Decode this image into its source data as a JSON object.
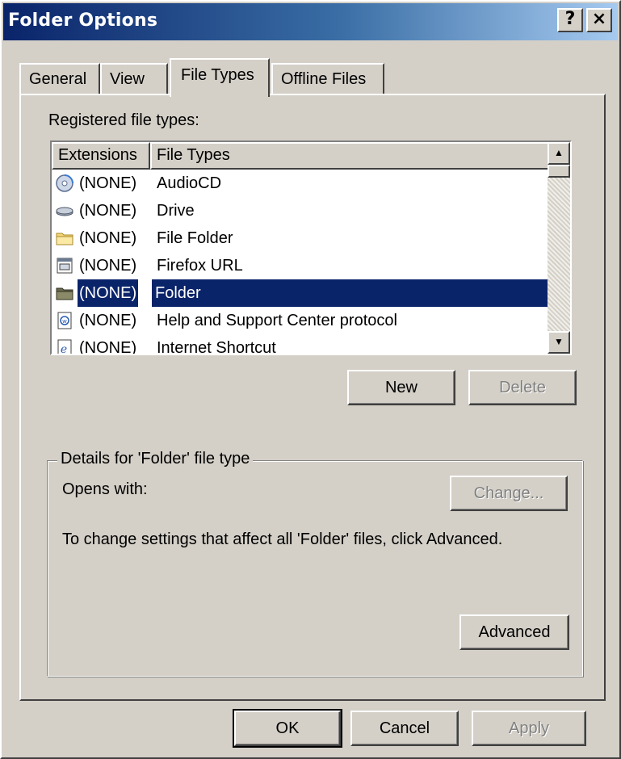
{
  "window": {
    "title": "Folder Options",
    "help_button": "?",
    "close_button": "×"
  },
  "tabs": [
    {
      "label": "General",
      "active": false
    },
    {
      "label": "View",
      "active": false
    },
    {
      "label": "File Types",
      "active": true
    },
    {
      "label": "Offline Files",
      "active": false
    }
  ],
  "file_types": {
    "label": "Registered file types:",
    "columns": [
      "Extensions",
      "File Types"
    ],
    "rows": [
      {
        "icon": "audio-cd-icon",
        "extension": "(NONE)",
        "type": "AudioCD",
        "selected": false
      },
      {
        "icon": "drive-icon",
        "extension": "(NONE)",
        "type": "Drive",
        "selected": false
      },
      {
        "icon": "file-folder-icon",
        "extension": "(NONE)",
        "type": "File Folder",
        "selected": false
      },
      {
        "icon": "url-document-icon",
        "extension": "(NONE)",
        "type": "Firefox URL",
        "selected": false
      },
      {
        "icon": "folder-icon",
        "extension": "(NONE)",
        "type": "Folder",
        "selected": true
      },
      {
        "icon": "help-document-icon",
        "extension": "(NONE)",
        "type": "Help and Support Center protocol",
        "selected": false
      },
      {
        "icon": "internet-shortcut-icon",
        "extension": "(NONE)",
        "type": "Internet Shortcut",
        "selected": false
      }
    ],
    "new_button": "New",
    "delete_button": "Delete"
  },
  "details": {
    "legend": "Details for 'Folder' file type",
    "opens_with_label": "Opens with:",
    "change_button": "Change...",
    "description": "To change settings that affect all 'Folder' files, click Advanced.",
    "advanced_button": "Advanced"
  },
  "footer": {
    "ok_button": "OK",
    "cancel_button": "Cancel",
    "apply_button": "Apply"
  },
  "colors": {
    "selection": "#0a246a",
    "face": "#d4d0c8",
    "disabled_text": "#808080"
  }
}
